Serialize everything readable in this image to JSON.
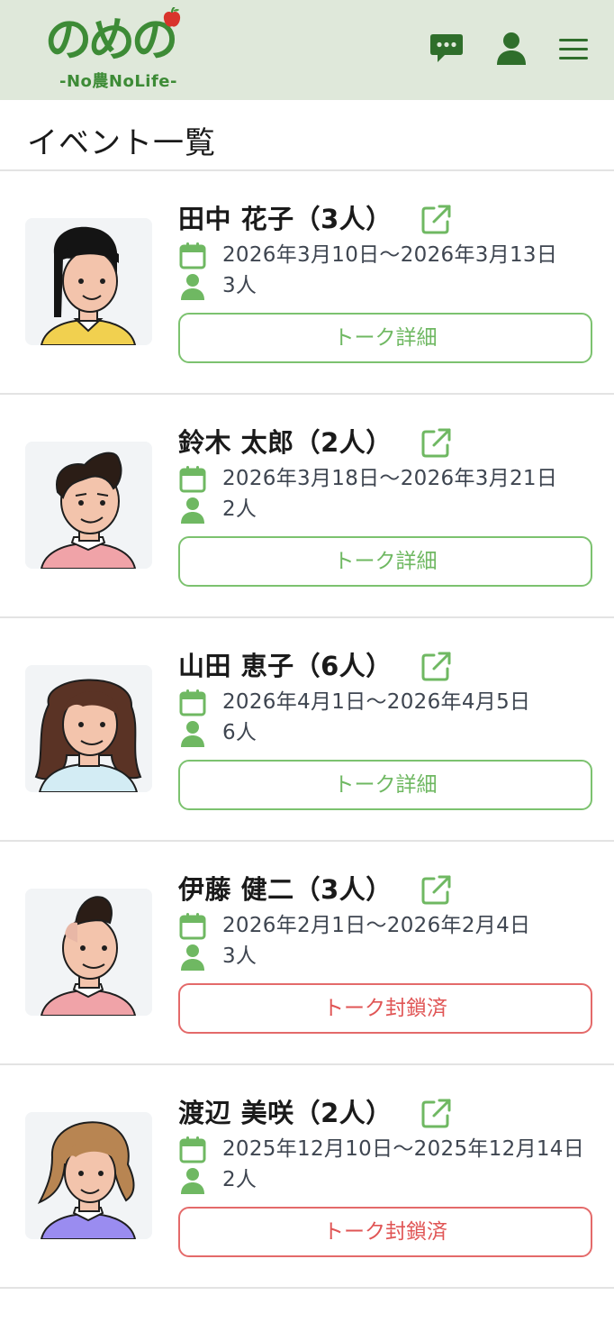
{
  "header": {
    "logo_mark": "のめの",
    "logo_tagline": "-No農NoLife-",
    "brand_color": "#3d8b36",
    "icons": [
      "chat-icon",
      "user-icon",
      "menu-icon"
    ]
  },
  "page": {
    "title": "イベント一覧"
  },
  "events": [
    {
      "name": "田中 花子（3人）",
      "dates": "2026年3月10日〜2026年3月13日",
      "people": "3人",
      "button": "トーク詳細",
      "status": "open"
    },
    {
      "name": "鈴木 太郎（2人）",
      "dates": "2026年3月18日〜2026年3月21日",
      "people": "2人",
      "button": "トーク詳細",
      "status": "open"
    },
    {
      "name": "山田 恵子（6人）",
      "dates": "2026年4月1日〜2026年4月5日",
      "people": "6人",
      "button": "トーク詳細",
      "status": "open"
    },
    {
      "name": "伊藤 健二（3人）",
      "dates": "2026年2月1日〜2026年2月4日",
      "people": "3人",
      "button": "トーク封鎖済",
      "status": "closed"
    },
    {
      "name": "渡辺 美咲（2人）",
      "dates": "2025年12月10日〜2025年12月14日",
      "people": "2人",
      "button": "トーク封鎖済",
      "status": "closed"
    }
  ],
  "colors": {
    "header_bg": "#dfe8da",
    "accent_green": "#6fb862",
    "closed_red": "#e05555"
  }
}
